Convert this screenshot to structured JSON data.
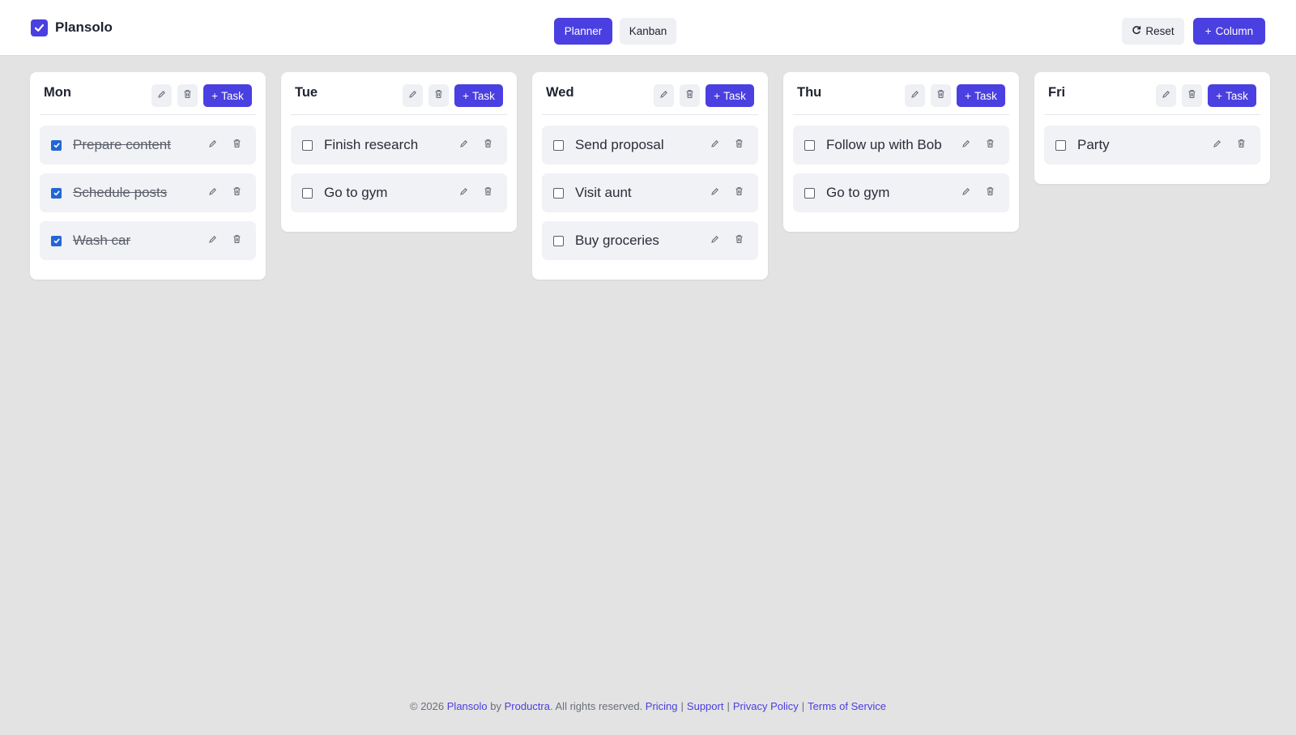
{
  "app": {
    "name": "Plansolo"
  },
  "views": {
    "planner": "Planner",
    "kanban": "Kanban",
    "active": "planner"
  },
  "actions": {
    "reset": "Reset",
    "add_column": "Column",
    "add_task": "Task"
  },
  "colors": {
    "accent": "#4a3fe0",
    "checkbox": "#2266d6",
    "background": "#e3e3e3"
  },
  "columns": [
    {
      "title": "Mon",
      "tasks": [
        {
          "label": "Prepare content",
          "done": true
        },
        {
          "label": "Schedule posts",
          "done": true
        },
        {
          "label": "Wash car",
          "done": true
        }
      ]
    },
    {
      "title": "Tue",
      "tasks": [
        {
          "label": "Finish research",
          "done": false
        },
        {
          "label": "Go to gym",
          "done": false
        }
      ]
    },
    {
      "title": "Wed",
      "tasks": [
        {
          "label": "Send proposal",
          "done": false
        },
        {
          "label": "Visit aunt",
          "done": false
        },
        {
          "label": "Buy groceries",
          "done": false
        }
      ]
    },
    {
      "title": "Thu",
      "tasks": [
        {
          "label": "Follow up with Bob",
          "done": false
        },
        {
          "label": "Go to gym",
          "done": false
        }
      ]
    },
    {
      "title": "Fri",
      "tasks": [
        {
          "label": "Party",
          "done": false
        }
      ]
    }
  ],
  "footer": {
    "copyright": "© 2026",
    "brand": "Plansolo",
    "by": "by",
    "company": "Productra",
    "rights": ". All rights reserved.",
    "links": [
      "Pricing",
      "Support",
      "Privacy Policy",
      "Terms of Service"
    ]
  }
}
